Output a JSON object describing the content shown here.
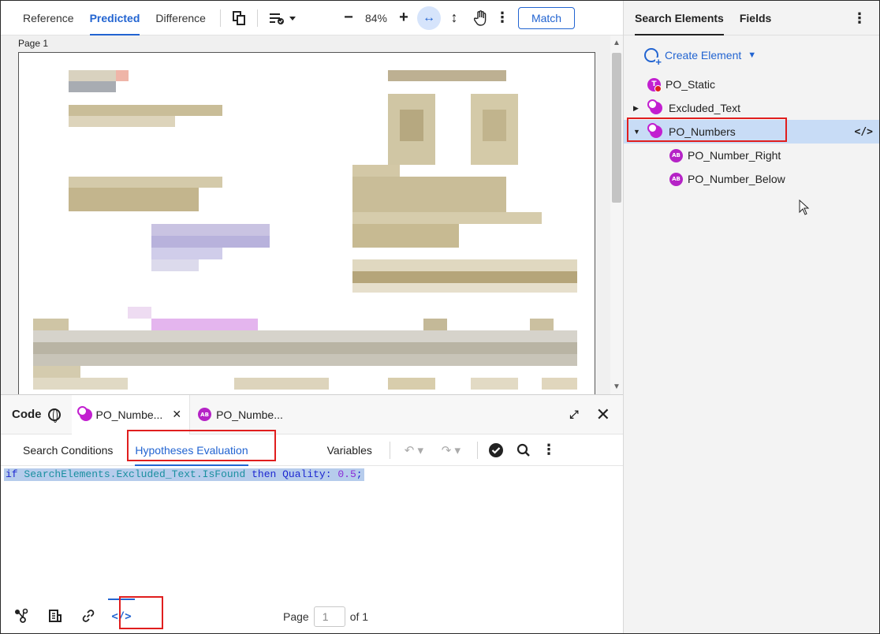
{
  "viewer": {
    "tabs": [
      "Reference",
      "Predicted",
      "Difference"
    ],
    "active_tab": "Predicted",
    "zoom": "84%",
    "match_label": "Match",
    "page_label": "Page 1"
  },
  "code_panel": {
    "title": "Code",
    "tabs": [
      {
        "label": "PO_Numbe...",
        "icon": "group-element-icon",
        "closable": true
      },
      {
        "label": "PO_Numbe...",
        "icon": "ab-element-icon",
        "closable": false
      }
    ],
    "subtabs": [
      "Search Conditions",
      "Hypotheses Evaluation",
      "Variables"
    ],
    "active_subtab": "Hypotheses Evaluation",
    "code": {
      "kw_if": "if",
      "object": "SearchElements.Excluded_Text.IsFound",
      "kw_then": "then",
      "quality_label": "Quality:",
      "quality_value": "0.5",
      "terminator": ";"
    },
    "footer": {
      "page_prefix": "Page",
      "page_value": "1",
      "page_suffix": "of 1"
    }
  },
  "right_panel": {
    "tabs": [
      "Search Elements",
      "Fields"
    ],
    "active_tab": "Search Elements",
    "create_label": "Create Element",
    "tree": [
      {
        "label": "PO_Static",
        "icon": "static-element-icon",
        "level": 0,
        "caret": ""
      },
      {
        "label": "Excluded_Text",
        "icon": "group-element-icon",
        "level": 0,
        "caret": "collapsed"
      },
      {
        "label": "PO_Numbers",
        "icon": "group-element-icon",
        "level": 0,
        "caret": "expanded",
        "selected": true
      },
      {
        "label": "PO_Number_Right",
        "icon": "ab-element-icon",
        "level": 1,
        "caret": ""
      },
      {
        "label": "PO_Number_Below",
        "icon": "ab-element-icon",
        "level": 1,
        "caret": ""
      }
    ]
  },
  "colors": {
    "accent": "#2264d1",
    "element_magenta": "#c21fd0",
    "selection": "#c8dcf6",
    "highlight_box": "#e01e1e"
  }
}
